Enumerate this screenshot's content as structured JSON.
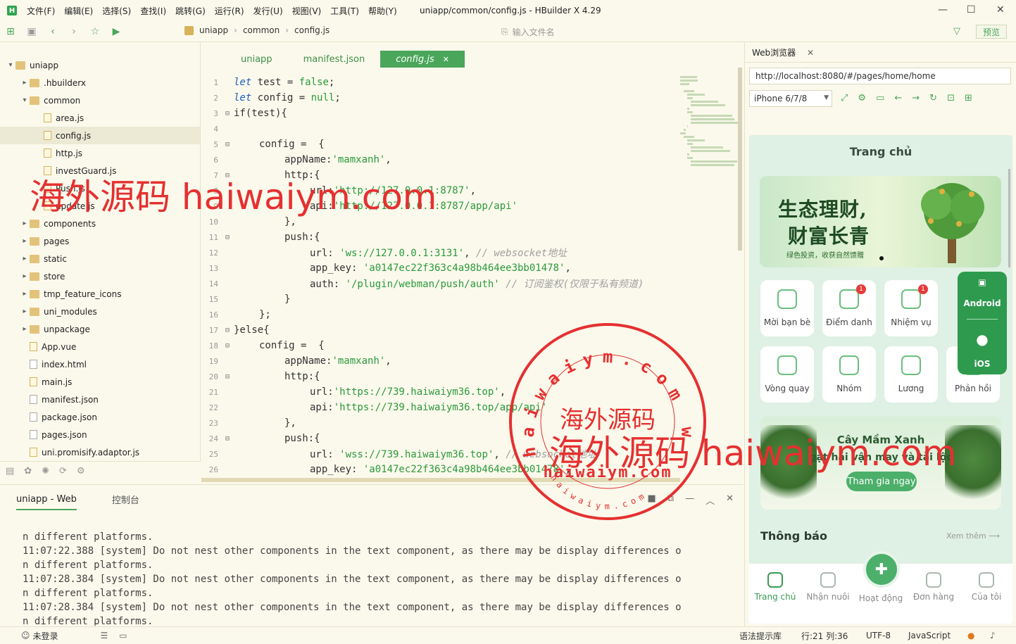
{
  "menubar": {
    "logo": "H",
    "items": [
      "文件(F)",
      "编辑(E)",
      "选择(S)",
      "查找(I)",
      "跳转(G)",
      "运行(R)",
      "发行(U)",
      "视图(V)",
      "工具(T)",
      "帮助(Y)"
    ],
    "window_title": "uniapp/common/config.js - HBuilder X 4.29",
    "minimize": "—",
    "maximize": "☐",
    "close": "✕"
  },
  "toolbar": {
    "breadcrumb": [
      "uniapp",
      "common",
      "config.js"
    ],
    "file_search_placeholder": "输入文件名",
    "preview_label": "预览"
  },
  "sidebar": {
    "tree": [
      {
        "label": "uniapp",
        "indent": 0,
        "type": "folder",
        "arrow": "▾"
      },
      {
        "label": ".hbuilderx",
        "indent": 1,
        "type": "folder",
        "arrow": "▸"
      },
      {
        "label": "common",
        "indent": 1,
        "type": "folder",
        "arrow": "▾"
      },
      {
        "label": "area.js",
        "indent": 2,
        "type": "file",
        "arrow": ""
      },
      {
        "label": "config.js",
        "indent": 2,
        "type": "file",
        "arrow": "",
        "selected": true
      },
      {
        "label": "http.js",
        "indent": 2,
        "type": "file",
        "arrow": ""
      },
      {
        "label": "investGuard.js",
        "indent": 2,
        "type": "file",
        "arrow": ""
      },
      {
        "label": "Push.js",
        "indent": 2,
        "type": "file",
        "arrow": ""
      },
      {
        "label": "update.js",
        "indent": 2,
        "type": "file",
        "arrow": ""
      },
      {
        "label": "components",
        "indent": 1,
        "type": "folder",
        "arrow": "▸"
      },
      {
        "label": "pages",
        "indent": 1,
        "type": "folder",
        "arrow": "▸"
      },
      {
        "label": "static",
        "indent": 1,
        "type": "folder",
        "arrow": "▸"
      },
      {
        "label": "store",
        "indent": 1,
        "type": "folder",
        "arrow": "▸"
      },
      {
        "label": "tmp_feature_icons",
        "indent": 1,
        "type": "folder",
        "arrow": "▸"
      },
      {
        "label": "uni_modules",
        "indent": 1,
        "type": "folder",
        "arrow": "▸"
      },
      {
        "label": "unpackage",
        "indent": 1,
        "type": "folder",
        "arrow": "▸"
      },
      {
        "label": "App.vue",
        "indent": 1,
        "type": "file",
        "arrow": ""
      },
      {
        "label": "index.html",
        "indent": 1,
        "type": "fileg",
        "arrow": ""
      },
      {
        "label": "main.js",
        "indent": 1,
        "type": "file",
        "arrow": ""
      },
      {
        "label": "manifest.json",
        "indent": 1,
        "type": "fileg",
        "arrow": ""
      },
      {
        "label": "package.json",
        "indent": 1,
        "type": "fileg",
        "arrow": ""
      },
      {
        "label": "pages.json",
        "indent": 1,
        "type": "fileg",
        "arrow": ""
      },
      {
        "label": "uni.promisify.adaptor.js",
        "indent": 1,
        "type": "file",
        "arrow": ""
      }
    ]
  },
  "editor": {
    "tabs": [
      {
        "label": "uniapp",
        "active": false
      },
      {
        "label": "manifest.json",
        "active": false
      },
      {
        "label": "config.js",
        "active": true
      }
    ],
    "tab_close": "✕",
    "lines": [
      {
        "n": "1",
        "fold": "",
        "indent": 0,
        "parts": [
          [
            "kw",
            "let"
          ],
          [
            "ct",
            " test = "
          ],
          [
            "str",
            "false"
          ],
          [
            "ct",
            ";"
          ]
        ]
      },
      {
        "n": "2",
        "fold": "",
        "indent": 0,
        "parts": [
          [
            "kw",
            "let"
          ],
          [
            "ct",
            " config = "
          ],
          [
            "str",
            "null"
          ],
          [
            "ct",
            ";"
          ]
        ]
      },
      {
        "n": "3",
        "fold": "⊟",
        "indent": 0,
        "parts": [
          [
            "ct",
            "if(test){"
          ]
        ]
      },
      {
        "n": "4",
        "fold": "",
        "indent": 0,
        "parts": []
      },
      {
        "n": "5",
        "fold": "⊟",
        "indent": 1,
        "parts": [
          [
            "ct",
            "config =  {"
          ]
        ]
      },
      {
        "n": "6",
        "fold": "",
        "indent": 2,
        "parts": [
          [
            "ct",
            "appName:"
          ],
          [
            "str",
            "'mamxanh'"
          ],
          [
            "ct",
            ","
          ]
        ]
      },
      {
        "n": "7",
        "fold": "⊟",
        "indent": 2,
        "parts": [
          [
            "ct",
            "http:{"
          ]
        ]
      },
      {
        "n": "8",
        "fold": "",
        "indent": 3,
        "parts": [
          [
            "ct",
            "url:"
          ],
          [
            "str",
            "'http://127.0.0.1:8787'"
          ],
          [
            "ct",
            ","
          ]
        ]
      },
      {
        "n": "9",
        "fold": "",
        "indent": 3,
        "parts": [
          [
            "ct",
            "api:"
          ],
          [
            "str",
            "'http://127.0.0.1:8787/app/api'"
          ]
        ]
      },
      {
        "n": "10",
        "fold": "",
        "indent": 2,
        "parts": [
          [
            "ct",
            "},"
          ]
        ]
      },
      {
        "n": "11",
        "fold": "⊟",
        "indent": 2,
        "parts": [
          [
            "ct",
            "push:{"
          ]
        ]
      },
      {
        "n": "12",
        "fold": "",
        "indent": 3,
        "parts": [
          [
            "ct",
            "url: "
          ],
          [
            "str",
            "'ws://127.0.0.1:3131'"
          ],
          [
            "ct",
            ", "
          ],
          [
            "cm",
            "// websocket地址"
          ]
        ]
      },
      {
        "n": "13",
        "fold": "",
        "indent": 3,
        "parts": [
          [
            "ct",
            "app_key: "
          ],
          [
            "str",
            "'a0147ec22f363c4a98b464ee3bb01478'"
          ],
          [
            "ct",
            ","
          ]
        ]
      },
      {
        "n": "14",
        "fold": "",
        "indent": 3,
        "parts": [
          [
            "ct",
            "auth: "
          ],
          [
            "str",
            "'/plugin/webman/push/auth'"
          ],
          [
            "ct",
            " "
          ],
          [
            "cm",
            "// 订阅鉴权(仅限于私有频道)"
          ]
        ]
      },
      {
        "n": "15",
        "fold": "",
        "indent": 2,
        "parts": [
          [
            "ct",
            "}"
          ]
        ]
      },
      {
        "n": "16",
        "fold": "",
        "indent": 1,
        "parts": [
          [
            "ct",
            "};"
          ]
        ]
      },
      {
        "n": "17",
        "fold": "⊟",
        "indent": 0,
        "parts": [
          [
            "ct",
            "}else{"
          ]
        ]
      },
      {
        "n": "18",
        "fold": "⊟",
        "indent": 1,
        "parts": [
          [
            "ct",
            "config =  {"
          ]
        ]
      },
      {
        "n": "19",
        "fold": "",
        "indent": 2,
        "parts": [
          [
            "ct",
            "appName:"
          ],
          [
            "str",
            "'mamxanh'"
          ],
          [
            "ct",
            ","
          ]
        ]
      },
      {
        "n": "20",
        "fold": "⊟",
        "indent": 2,
        "parts": [
          [
            "ct",
            "http:{"
          ]
        ]
      },
      {
        "n": "21",
        "fold": "",
        "indent": 3,
        "parts": [
          [
            "ct",
            "url:"
          ],
          [
            "str",
            "'https://739.haiwaiym36.top'"
          ],
          [
            "ct",
            ","
          ]
        ]
      },
      {
        "n": "22",
        "fold": "",
        "indent": 3,
        "parts": [
          [
            "ct",
            "api:"
          ],
          [
            "str",
            "'https://739.haiwaiym36.top/app/api'"
          ]
        ]
      },
      {
        "n": "23",
        "fold": "",
        "indent": 2,
        "parts": [
          [
            "ct",
            "},"
          ]
        ]
      },
      {
        "n": "24",
        "fold": "⊟",
        "indent": 2,
        "parts": [
          [
            "ct",
            "push:{"
          ]
        ]
      },
      {
        "n": "25",
        "fold": "",
        "indent": 3,
        "parts": [
          [
            "ct",
            "url: "
          ],
          [
            "str",
            "'wss://739.haiwaiym36.top'"
          ],
          [
            "ct",
            ", "
          ],
          [
            "cm",
            "// websocket地址"
          ]
        ]
      },
      {
        "n": "26",
        "fold": "",
        "indent": 3,
        "parts": [
          [
            "ct",
            "app_key: "
          ],
          [
            "str",
            "'a0147ec22f363c4a98b464ee3bb01478'"
          ],
          [
            "ct",
            ","
          ]
        ]
      }
    ]
  },
  "console": {
    "tabs": [
      {
        "label": "uniapp - Web",
        "active": true
      },
      {
        "label": "控制台",
        "active": false
      }
    ],
    "lines": [
      "n different platforms.",
      "11:07:22.388 [system] Do not nest other components in the text component, as there may be display differences o",
      "n different platforms.",
      "11:07:28.384 [system] Do not nest other components in the text component, as there may be display differences o",
      "n different platforms.",
      "11:07:28.384 [system] Do not nest other components in the text component, as there may be display differences o",
      "n different platforms."
    ]
  },
  "statusbar": {
    "login": "未登录",
    "syntax_hint": "语法提示库",
    "position": "行:21    列:36",
    "encoding": "UTF-8",
    "language": "JavaScript"
  },
  "browser": {
    "tab_label": "Web浏览器",
    "tab_close": "✕",
    "url": "http://localhost:8080/#/pages/home/home",
    "device": "iPhone 6/7/8",
    "device_arrow": "▼"
  },
  "phone": {
    "title": "Trang chủ",
    "banner": {
      "line1": "生态理财,",
      "line2": "财富长青",
      "sub": "绿色投资，收获自然馈赠"
    },
    "grid": [
      {
        "label": "Mời bạn bè",
        "badge": ""
      },
      {
        "label": "Điểm danh",
        "badge": "1"
      },
      {
        "label": "Nhiệm vụ",
        "badge": "1"
      },
      {
        "label": "Vòng quay",
        "badge": ""
      },
      {
        "label": "Nhóm",
        "badge": ""
      },
      {
        "label": "Lương",
        "badge": ""
      },
      {
        "label": "Phản hồi",
        "badge": ""
      }
    ],
    "os_panel": {
      "android": "Android",
      "ios": "iOS"
    },
    "promo": {
      "line1": "Cây Mầm Xanh",
      "line2": "gặt hái vận may và tài lộc",
      "button": "Tham gia ngay"
    },
    "notice": {
      "title": "Thông báo",
      "more": "Xem thêm ⟶"
    },
    "nav": [
      {
        "label": "Trang chủ",
        "active": true
      },
      {
        "label": "Nhận nuôi",
        "active": false
      },
      {
        "label": "Hoạt động",
        "active": false
      },
      {
        "label": "Đơn hàng",
        "active": false
      },
      {
        "label": "Của tôi",
        "active": false
      }
    ]
  },
  "watermark": {
    "text1": "海外源码 haiwaiym.com",
    "text2": "海外源码 haiwaiym.com",
    "stamp_arc": "haiwaiym.com www.",
    "stamp_center": "海外源码",
    "stamp_url": "haiwaiym.com",
    "stamp_bottom": "haiwaiym.com"
  },
  "colors": {
    "accent": "#4aa65a",
    "watermark": "#e53030",
    "phone_bg": "#dff0e4"
  }
}
